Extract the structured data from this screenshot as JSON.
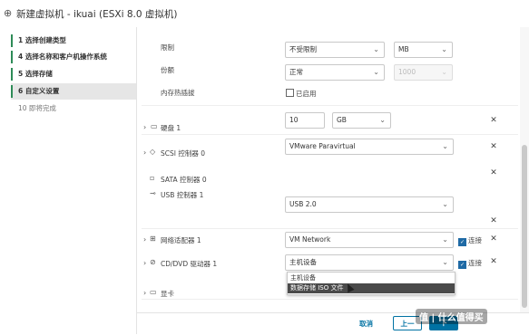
{
  "title": "新建虚拟机 - ikuai (ESXi 8.0 虚拟机)",
  "steps": [
    {
      "label": "1  选择创建类型"
    },
    {
      "label": "4  选择名称和客户机操作系统"
    },
    {
      "label": "5  选择存储"
    },
    {
      "label": "6  自定义设置"
    },
    {
      "label": "10  即将完成"
    }
  ],
  "rows": {
    "limit": {
      "label": "限制",
      "value": "不受限制",
      "unit": "MB"
    },
    "shares": {
      "label": "份额",
      "value": "正常",
      "num": "1000"
    },
    "hotplug": {
      "label": "内存热插拔",
      "checkbox": "已启用"
    },
    "disk": {
      "label": "硬盘 1",
      "size": "10",
      "unit": "GB"
    },
    "scsi": {
      "label": "SCSI 控制器 0",
      "value": "VMware Paravirtual"
    },
    "sata": {
      "label": "SATA 控制器 0"
    },
    "usb": {
      "label": "USB 控制器 1",
      "value": "USB 2.0"
    },
    "net": {
      "label": "网络适配器 1",
      "value": "VM Network",
      "connect": "连接"
    },
    "cd": {
      "label": "CD/DVD 驱动器 1",
      "value": "主机设备",
      "connect": "连接"
    },
    "gpu": {
      "label": "显卡"
    }
  },
  "dropdown": {
    "options": [
      "主机设备",
      "数据存储 ISO 文件"
    ],
    "selected_index": 1
  },
  "footer": {
    "cancel": "取消",
    "back": "上一",
    "next": "下"
  },
  "watermark": "值 | 什么值得买",
  "colors": {
    "accent": "#0072a3",
    "step_bar": "#2e8b57"
  }
}
